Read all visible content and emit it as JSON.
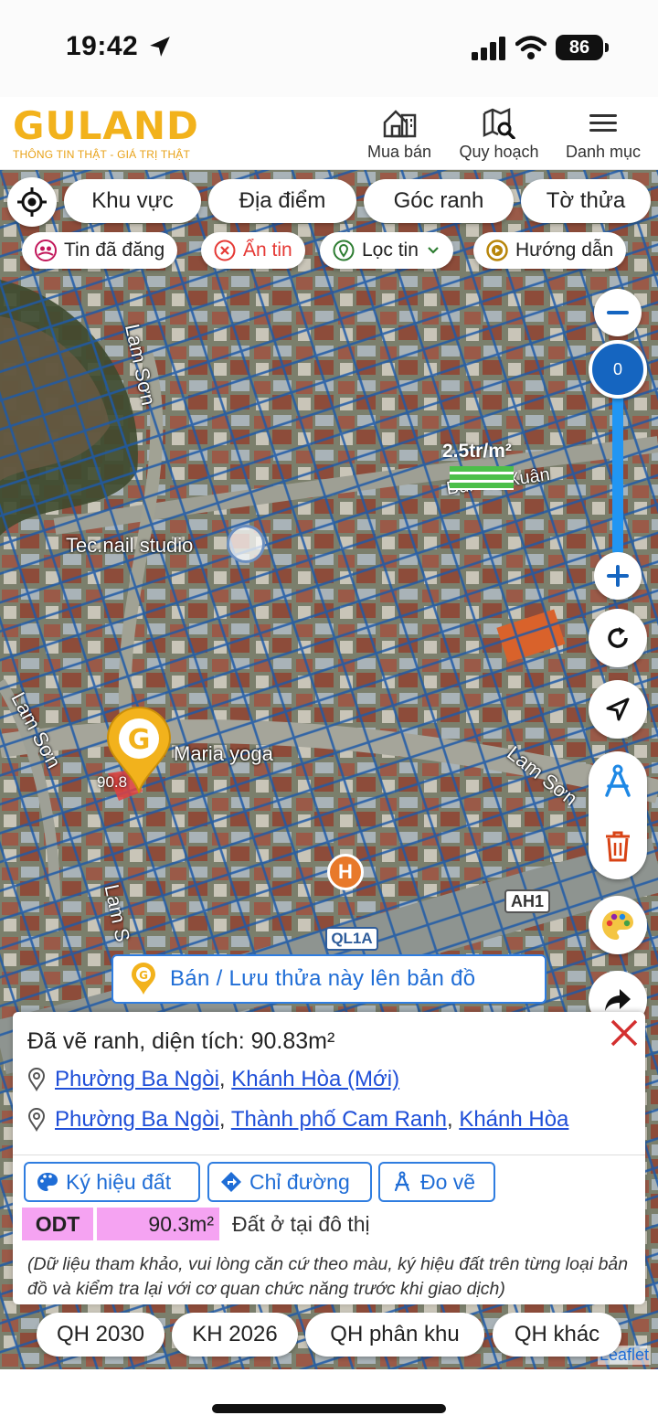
{
  "status_bar": {
    "time": "19:42",
    "battery": "86"
  },
  "header": {
    "logo_text": "GULAND",
    "logo_tagline": "THÔNG TIN THẬT - GIÁ TRỊ THẬT",
    "nav": [
      {
        "label": "Mua bán",
        "icon": "store-icon"
      },
      {
        "label": "Quy hoạch",
        "icon": "map-search-icon"
      },
      {
        "label": "Danh mục",
        "icon": "menu-icon"
      }
    ]
  },
  "toolbar": {
    "row1": [
      "Khu vực",
      "Địa điểm",
      "Góc ranh",
      "Tờ thửa"
    ],
    "row2": [
      {
        "label": "Tin đã đăng",
        "icon": "user-group-icon",
        "color": "#c2185b"
      },
      {
        "label": "Ẩn tin",
        "icon": "close-circle-icon",
        "color": "#e53935"
      },
      {
        "label": "Lọc tin",
        "icon": "location-icon",
        "color": "#2e7d32"
      },
      {
        "label": "Hướng dẫn",
        "icon": "play-circle-icon",
        "color": "#b8860b"
      }
    ]
  },
  "map": {
    "zoom_value": "0",
    "price_label": "2.5tr/m²",
    "place_labels": {
      "lam_son_top": "Lam Sơn",
      "studio": "Tec.nail studio",
      "maria_yoga": "Maria yoga",
      "lam_son_left": "Lam Sơn",
      "lam_son_right": "Lam Sơn",
      "lam_son_bottom": "Lam S",
      "thi_xuan": "Bùi Thị Xuân",
      "ah1": "AH1",
      "ql1a": "QL1A",
      "marker_area": "90.8"
    },
    "save_button": "Bán / Lưu thửa này lên bản đồ",
    "attribution": "Leaflet"
  },
  "panel": {
    "title": "Đã vẽ ranh, diện tích: 90.83m²",
    "address1": {
      "ward": "Phường Ba Ngòi",
      "province": "Khánh Hòa (Mới)"
    },
    "address2": {
      "ward": "Phường Ba Ngòi",
      "city": "Thành phố Cam Ranh",
      "province": "Khánh Hòa"
    },
    "actions": [
      "Ký hiệu đất",
      "Chỉ đường",
      "Đo vẽ"
    ],
    "land_code": "ODT",
    "land_area": "90.3m²",
    "land_desc": "Đất ở tại đô thị",
    "note": "(Dữ liệu tham khảo, vui lòng căn cứ theo màu, ký hiệu đất trên từng loại bản đồ và kiểm tra lại với cơ quan chức năng trước khi giao dịch)"
  },
  "plan_tabs": [
    "QH 2030",
    "KH 2026",
    "QH phân khu",
    "QH khác"
  ]
}
